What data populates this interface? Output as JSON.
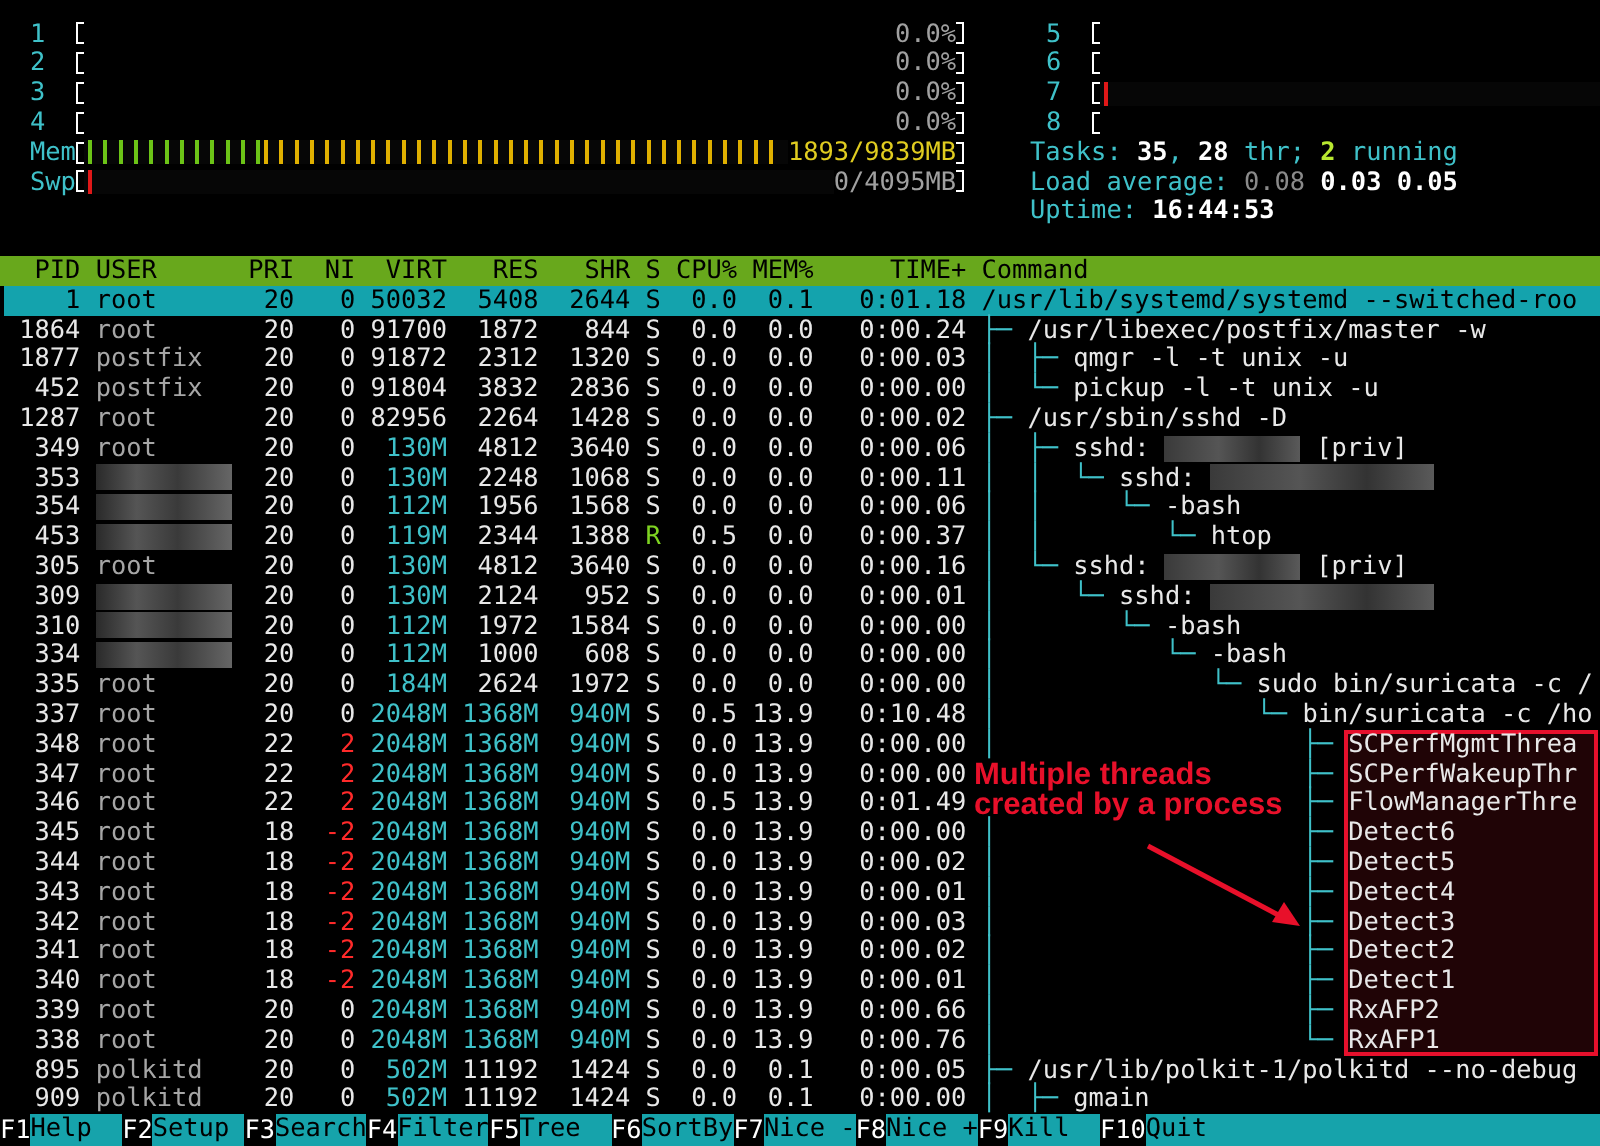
{
  "meters_left": [
    {
      "label": "1",
      "kind": "cpu",
      "reading": "0.0%",
      "cut_off": false
    },
    {
      "label": "2",
      "kind": "cpu",
      "reading": "0.0%",
      "cut_off": false
    },
    {
      "label": "3",
      "kind": "cpu",
      "reading": "0.0%",
      "cut_off": false
    },
    {
      "label": "4",
      "kind": "cpu",
      "reading": "0.0%",
      "cut_off": false
    },
    {
      "label": "Mem",
      "kind": "mem",
      "segments": [
        {
          "level": 0.25,
          "color": "#6cc417"
        },
        {
          "level": 0.74,
          "color": "#e0b000"
        }
      ],
      "reading": "1893/9839MB",
      "cut_off": false
    },
    {
      "label": "Swp",
      "kind": "swap",
      "level": 0.025,
      "reading": "0/4095MB",
      "cut_off": false
    }
  ],
  "meters_right": [
    {
      "label": "5",
      "kind": "cpu",
      "cut_off": true
    },
    {
      "label": "6",
      "kind": "cpu",
      "cut_off": true
    },
    {
      "label": "7",
      "kind": "cpu",
      "level": 0.035,
      "cut_off": true
    },
    {
      "label": "8",
      "kind": "cpu",
      "cut_off": true
    }
  ],
  "info_lines": [
    {
      "parts": [
        {
          "text": "Tasks: ",
          "kind": "label"
        },
        {
          "text": "35",
          "kind": "value"
        },
        {
          "text": ", ",
          "kind": "label"
        },
        {
          "text": "28",
          "kind": "value"
        },
        {
          "text": " thr; ",
          "kind": "label"
        },
        {
          "text": "2",
          "kind": "running"
        },
        {
          "text": " running",
          "kind": "label"
        }
      ]
    },
    {
      "parts": [
        {
          "text": "Load average: ",
          "kind": "label"
        },
        {
          "text": "0.08 ",
          "kind": "dim"
        },
        {
          "text": "0.03 ",
          "kind": "value"
        },
        {
          "text": "0.05",
          "kind": "value"
        }
      ]
    },
    {
      "parts": [
        {
          "text": "Uptime: ",
          "kind": "label"
        },
        {
          "text": "16:44:53",
          "kind": "value"
        }
      ]
    }
  ],
  "columns": [
    "PID",
    "USER",
    "PRI",
    "NI",
    "VIRT",
    "RES",
    "SHR",
    "S",
    "CPU%",
    "MEM%",
    "TIME+",
    "Command"
  ],
  "rows": [
    {
      "pid": "1",
      "user": "root",
      "pri": "20",
      "ni": "0",
      "niced": false,
      "virt": "50032",
      "res": "5408",
      "shr": "2644",
      "state": "S",
      "running": false,
      "cpu": "0.0",
      "mem": "0.1",
      "time": "0:01.18",
      "command": "/usr/lib/systemd/systemd --switched-roo",
      "selected": true
    },
    {
      "pid": "1864",
      "user": "root",
      "pri": "20",
      "ni": "0",
      "niced": false,
      "virt": "91700",
      "res": "1872",
      "shr": "844",
      "state": "S",
      "running": false,
      "cpu": "0.0",
      "mem": "0.0",
      "time": "0:00.24",
      "tree": "├─ ",
      "command": "/usr/libexec/postfix/master -w",
      "selected": false
    },
    {
      "pid": "1877",
      "user": "postfix",
      "pri": "20",
      "ni": "0",
      "niced": false,
      "virt": "91872",
      "res": "2312",
      "shr": "1320",
      "state": "S",
      "running": false,
      "cpu": "0.0",
      "mem": "0.0",
      "time": "0:00.03",
      "tree": "│  ├─ ",
      "command": "qmgr -l -t unix -u",
      "selected": false
    },
    {
      "pid": "452",
      "user": "postfix",
      "pri": "20",
      "ni": "0",
      "niced": false,
      "virt": "91804",
      "res": "3832",
      "shr": "2836",
      "state": "S",
      "running": false,
      "cpu": "0.0",
      "mem": "0.0",
      "time": "0:00.00",
      "tree": "│  └─ ",
      "command": "pickup -l -t unix -u",
      "selected": false
    },
    {
      "pid": "1287",
      "user": "root",
      "pri": "20",
      "ni": "0",
      "niced": false,
      "virt": "82956",
      "res": "2264",
      "shr": "1428",
      "state": "S",
      "running": false,
      "cpu": "0.0",
      "mem": "0.0",
      "time": "0:00.02",
      "tree": "├─ ",
      "command": "/usr/sbin/sshd -D",
      "selected": false
    },
    {
      "pid": "349",
      "user": "root",
      "pri": "20",
      "ni": "0",
      "niced": false,
      "virt": "130M",
      "res": "4812",
      "shr": "3640",
      "state": "S",
      "running": false,
      "cpu": "0.0",
      "mem": "0.0",
      "time": "0:00.06",
      "tree": "│  ├─ ",
      "command": "sshd:",
      "command_hidden": true,
      "command_tail": "[priv]",
      "selected": false
    },
    {
      "pid": "353",
      "user_hidden": true,
      "pri": "20",
      "ni": "0",
      "niced": false,
      "virt": "130M",
      "res": "2248",
      "shr": "1068",
      "state": "S",
      "running": false,
      "cpu": "0.0",
      "mem": "0.0",
      "time": "0:00.11",
      "tree": "│  │  └─ ",
      "command": "sshd:",
      "command_hidden": true,
      "selected": false
    },
    {
      "pid": "354",
      "user_hidden": true,
      "pri": "20",
      "ni": "0",
      "niced": false,
      "virt": "112M",
      "res": "1956",
      "shr": "1568",
      "state": "S",
      "running": false,
      "cpu": "0.0",
      "mem": "0.0",
      "time": "0:00.06",
      "tree": "│  │     └─ ",
      "command": "-bash",
      "selected": false
    },
    {
      "pid": "453",
      "user_hidden": true,
      "pri": "20",
      "ni": "0",
      "niced": false,
      "virt": "119M",
      "res": "2344",
      "shr": "1388",
      "state": "R",
      "running": true,
      "cpu": "0.5",
      "mem": "0.0",
      "time": "0:00.37",
      "tree": "│  │        └─ ",
      "command": "htop",
      "selected": false
    },
    {
      "pid": "305",
      "user": "root",
      "pri": "20",
      "ni": "0",
      "niced": false,
      "virt": "130M",
      "res": "4812",
      "shr": "3640",
      "state": "S",
      "running": false,
      "cpu": "0.0",
      "mem": "0.0",
      "time": "0:00.16",
      "tree": "│  └─ ",
      "command": "sshd:",
      "command_hidden": true,
      "command_tail": "[priv]",
      "selected": false
    },
    {
      "pid": "309",
      "user_hidden": true,
      "pri": "20",
      "ni": "0",
      "niced": false,
      "virt": "130M",
      "res": "2124",
      "shr": "952",
      "state": "S",
      "running": false,
      "cpu": "0.0",
      "mem": "0.0",
      "time": "0:00.01",
      "tree": "│     └─ ",
      "command": "sshd:",
      "command_hidden": true,
      "selected": false
    },
    {
      "pid": "310",
      "user_hidden": true,
      "pri": "20",
      "ni": "0",
      "niced": false,
      "virt": "112M",
      "res": "1972",
      "shr": "1584",
      "state": "S",
      "running": false,
      "cpu": "0.0",
      "mem": "0.0",
      "time": "0:00.00",
      "tree": "│        └─ ",
      "command": "-bash",
      "selected": false
    },
    {
      "pid": "334",
      "user_hidden": true,
      "pri": "20",
      "ni": "0",
      "niced": false,
      "virt": "112M",
      "res": "1000",
      "shr": "608",
      "state": "S",
      "running": false,
      "cpu": "0.0",
      "mem": "0.0",
      "time": "0:00.00",
      "tree": "│           └─ ",
      "command": "-bash",
      "selected": false
    },
    {
      "pid": "335",
      "user": "root",
      "pri": "20",
      "ni": "0",
      "niced": false,
      "virt": "184M",
      "res": "2624",
      "shr": "1972",
      "state": "S",
      "running": false,
      "cpu": "0.0",
      "mem": "0.0",
      "time": "0:00.00",
      "tree": "│              └─ ",
      "command": "sudo bin/suricata -c /",
      "selected": false
    },
    {
      "pid": "337",
      "user": "root",
      "pri": "20",
      "ni": "0",
      "niced": false,
      "virt": "2048M",
      "res": "1368M",
      "shr": "940M",
      "state": "S",
      "running": false,
      "cpu": "0.5",
      "mem": "13.9",
      "time": "0:10.48",
      "tree": "│                 └─ ",
      "command": "bin/suricata -c /ho",
      "selected": false
    },
    {
      "pid": "348",
      "user": "root",
      "pri": "22",
      "ni": "2",
      "niced": true,
      "virt": "2048M",
      "res": "1368M",
      "shr": "940M",
      "state": "S",
      "running": false,
      "cpu": "0.0",
      "mem": "13.9",
      "time": "0:00.00",
      "tree": "│                    ├─ ",
      "command": "SCPerfMgmtThrea",
      "selected": false
    },
    {
      "pid": "347",
      "user": "root",
      "pri": "22",
      "ni": "2",
      "niced": true,
      "virt": "2048M",
      "res": "1368M",
      "shr": "940M",
      "state": "S",
      "running": false,
      "cpu": "0.0",
      "mem": "13.9",
      "time": "0:00.00",
      "tree": "                     ├─ ",
      "command": "SCPerfWakeupThr",
      "selected": false
    },
    {
      "pid": "346",
      "user": "root",
      "pri": "22",
      "ni": "2",
      "niced": true,
      "virt": "2048M",
      "res": "1368M",
      "shr": "940M",
      "state": "S",
      "running": false,
      "cpu": "0.5",
      "mem": "13.9",
      "time": "0:01.49",
      "tree": "                     ├─ ",
      "command": "FlowManagerThre",
      "selected": false
    },
    {
      "pid": "345",
      "user": "root",
      "pri": "18",
      "ni": "-2",
      "niced": true,
      "virt": "2048M",
      "res": "1368M",
      "shr": "940M",
      "state": "S",
      "running": false,
      "cpu": "0.0",
      "mem": "13.9",
      "time": "0:00.00",
      "tree": "│                    ├─ ",
      "command": "Detect6",
      "selected": false
    },
    {
      "pid": "344",
      "user": "root",
      "pri": "18",
      "ni": "-2",
      "niced": true,
      "virt": "2048M",
      "res": "1368M",
      "shr": "940M",
      "state": "S",
      "running": false,
      "cpu": "0.0",
      "mem": "13.9",
      "time": "0:00.02",
      "tree": "│                    ├─ ",
      "command": "Detect5",
      "selected": false
    },
    {
      "pid": "343",
      "user": "root",
      "pri": "18",
      "ni": "-2",
      "niced": true,
      "virt": "2048M",
      "res": "1368M",
      "shr": "940M",
      "state": "S",
      "running": false,
      "cpu": "0.0",
      "mem": "13.9",
      "time": "0:00.01",
      "tree": "│                    ├─ ",
      "command": "Detect4",
      "selected": false
    },
    {
      "pid": "342",
      "user": "root",
      "pri": "18",
      "ni": "-2",
      "niced": true,
      "virt": "2048M",
      "res": "1368M",
      "shr": "940M",
      "state": "S",
      "running": false,
      "cpu": "0.0",
      "mem": "13.9",
      "time": "0:00.03",
      "tree": "│                    ├─ ",
      "command": "Detect3",
      "selected": false
    },
    {
      "pid": "341",
      "user": "root",
      "pri": "18",
      "ni": "-2",
      "niced": true,
      "virt": "2048M",
      "res": "1368M",
      "shr": "940M",
      "state": "S",
      "running": false,
      "cpu": "0.0",
      "mem": "13.9",
      "time": "0:00.02",
      "tree": "│                    ├─ ",
      "command": "Detect2",
      "selected": false
    },
    {
      "pid": "340",
      "user": "root",
      "pri": "18",
      "ni": "-2",
      "niced": true,
      "virt": "2048M",
      "res": "1368M",
      "shr": "940M",
      "state": "S",
      "running": false,
      "cpu": "0.0",
      "mem": "13.9",
      "time": "0:00.01",
      "tree": "│                    ├─ ",
      "command": "Detect1",
      "selected": false
    },
    {
      "pid": "339",
      "user": "root",
      "pri": "20",
      "ni": "0",
      "niced": false,
      "virt": "2048M",
      "res": "1368M",
      "shr": "940M",
      "state": "S",
      "running": false,
      "cpu": "0.0",
      "mem": "13.9",
      "time": "0:00.66",
      "tree": "│                    ├─ ",
      "command": "RxAFP2",
      "selected": false
    },
    {
      "pid": "338",
      "user": "root",
      "pri": "20",
      "ni": "0",
      "niced": false,
      "virt": "2048M",
      "res": "1368M",
      "shr": "940M",
      "state": "S",
      "running": false,
      "cpu": "0.0",
      "mem": "13.9",
      "time": "0:00.76",
      "tree": "│                    └─ ",
      "command": "RxAFP1",
      "selected": false
    },
    {
      "pid": "895",
      "user": "polkitd",
      "pri": "20",
      "ni": "0",
      "niced": false,
      "virt": "502M",
      "res": "11192",
      "shr": "1424",
      "state": "S",
      "running": false,
      "cpu": "0.0",
      "mem": "0.1",
      "time": "0:00.05",
      "tree": "├─ ",
      "command": "/usr/lib/polkit-1/polkitd --no-debug",
      "selected": false
    },
    {
      "pid": "909",
      "user": "polkitd",
      "pri": "20",
      "ni": "0",
      "niced": false,
      "virt": "502M",
      "res": "11192",
      "shr": "1424",
      "state": "S",
      "running": false,
      "cpu": "0.0",
      "mem": "0.1",
      "time": "0:00.00",
      "tree": "│  ├─ ",
      "command": "gmain",
      "selected": false
    }
  ],
  "annotation": {
    "text": "Multiple threads created by a process"
  },
  "footer": [
    {
      "key": "F1",
      "label": "Help"
    },
    {
      "key": "F2",
      "label": "Setup"
    },
    {
      "key": "F3",
      "label": "Search"
    },
    {
      "key": "F4",
      "label": "Filter"
    },
    {
      "key": "F5",
      "label": "Tree"
    },
    {
      "key": "F6",
      "label": "SortBy"
    },
    {
      "key": "F7",
      "label": "Nice -"
    },
    {
      "key": "F8",
      "label": "Nice +"
    },
    {
      "key": "F9",
      "label": "Kill"
    },
    {
      "key": "F10",
      "label": "Quit"
    }
  ]
}
